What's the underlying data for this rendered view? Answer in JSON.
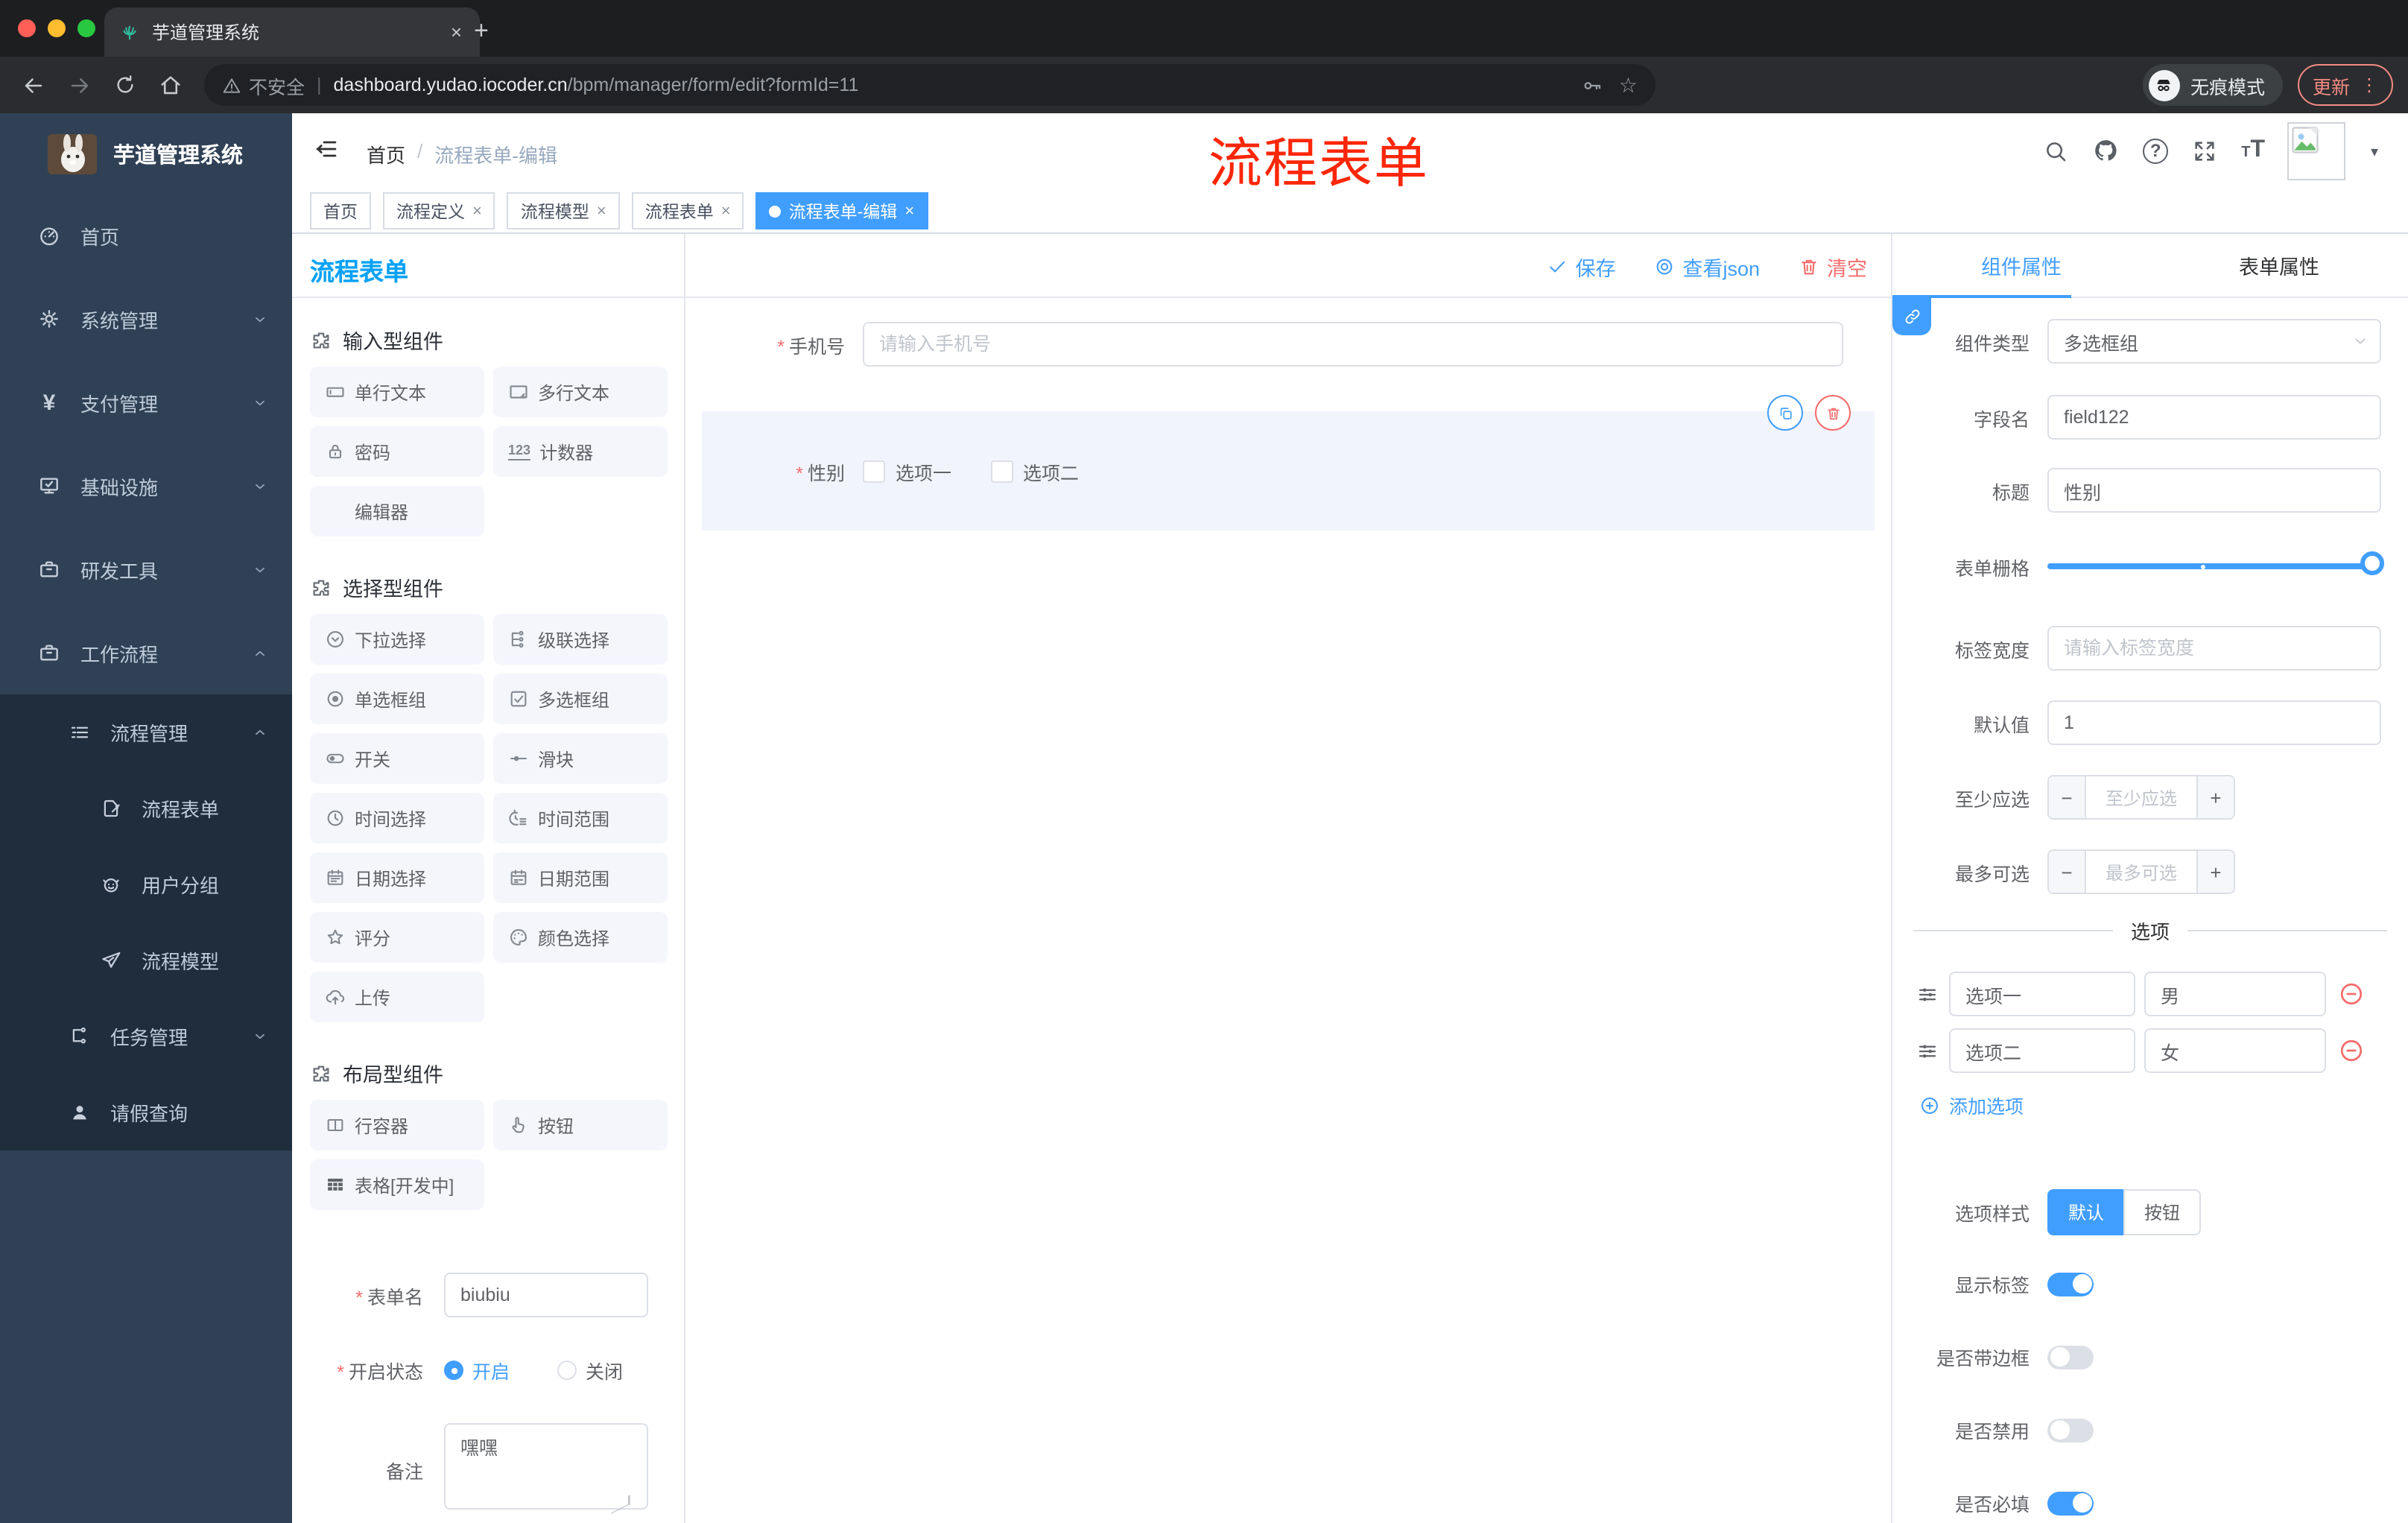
{
  "glyphs": {
    "close": "×",
    "caret": "▾",
    "slash": "/",
    "pipe": "|",
    "asterisk": "*",
    "question": "?",
    "dots": "⋮",
    "newtab": "+",
    "star": "☆",
    "yen": "¥",
    "counter": "123",
    "font_large": "T",
    "font_small": "T",
    "minus": "−",
    "plus": "+"
  },
  "colors": {
    "primary": "#409EFF",
    "danger": "#F56C6C",
    "palette_title": "#0aa2f5",
    "watermark": "#fc2608",
    "sidebar_bg": "#304156",
    "submenu_bg": "#1f2d3d",
    "active_tag": "#409EFF"
  },
  "browser": {
    "tab_title": "芋道管理系统",
    "security_label": "不安全",
    "url_host": "dashboard.yudao.iocoder.cn",
    "url_path": "/bpm/manager/form/edit?formId=11",
    "incognito_label": "无痕模式",
    "update_label": "更新"
  },
  "sidebar": {
    "logo_title": "芋道管理系统",
    "items": [
      {
        "label": "首页"
      },
      {
        "label": "系统管理"
      },
      {
        "label": "支付管理"
      },
      {
        "label": "基础设施"
      },
      {
        "label": "研发工具"
      },
      {
        "label": "工作流程"
      },
      {
        "label": "流程管理"
      },
      {
        "label": "流程表单"
      },
      {
        "label": "用户分组"
      },
      {
        "label": "流程模型"
      },
      {
        "label": "任务管理"
      },
      {
        "label": "请假查询"
      }
    ]
  },
  "header": {
    "breadcrumb_home": "首页",
    "breadcrumb_current": "流程表单-编辑",
    "watermark": "流程表单"
  },
  "tags": [
    {
      "label": "首页"
    },
    {
      "label": "流程定义"
    },
    {
      "label": "流程模型"
    },
    {
      "label": "流程表单"
    },
    {
      "label": "流程表单-编辑"
    }
  ],
  "palette": {
    "title": "流程表单",
    "sections": [
      {
        "title": "输入型组件",
        "items": [
          {
            "label": "单行文本"
          },
          {
            "label": "多行文本"
          },
          {
            "label": "密码"
          },
          {
            "label": "计数器"
          },
          {
            "label": "编辑器"
          }
        ]
      },
      {
        "title": "选择型组件",
        "items": [
          {
            "label": "下拉选择"
          },
          {
            "label": "级联选择"
          },
          {
            "label": "单选框组"
          },
          {
            "label": "多选框组"
          },
          {
            "label": "开关"
          },
          {
            "label": "滑块"
          },
          {
            "label": "时间选择"
          },
          {
            "label": "时间范围"
          },
          {
            "label": "日期选择"
          },
          {
            "label": "日期范围"
          },
          {
            "label": "评分"
          },
          {
            "label": "颜色选择"
          },
          {
            "label": "上传"
          }
        ]
      },
      {
        "title": "布局型组件",
        "items": [
          {
            "label": "行容器"
          },
          {
            "label": "按钮"
          },
          {
            "label": "表格[开发中]"
          }
        ]
      }
    ]
  },
  "form_meta": {
    "name_label": "表单名",
    "name_value": "biubiu",
    "status_label": "开启状态",
    "status_on": "开启",
    "status_off": "关闭",
    "remark_label": "备注",
    "remark_value": "嘿嘿"
  },
  "canvas": {
    "save_label": "保存",
    "view_json_label": "查看json",
    "clear_label": "清空",
    "phone_label": "手机号",
    "phone_placeholder": "请输入手机号",
    "gender_label": "性别",
    "gender_option1": "选项一",
    "gender_option2": "选项二"
  },
  "inspector": {
    "tab_component": "组件属性",
    "tab_form": "表单属性",
    "type_label": "组件类型",
    "type_value": "多选框组",
    "field_label": "字段名",
    "field_value": "field122",
    "title_label": "标题",
    "title_value": "性别",
    "grid_label": "表单栅格",
    "label_width_label": "标签宽度",
    "label_width_placeholder": "请输入标签宽度",
    "default_label": "默认值",
    "default_value": "1",
    "min_label": "至少应选",
    "min_placeholder": "至少应选",
    "max_label": "最多可选",
    "max_placeholder": "最多可选",
    "options_title": "选项",
    "options": [
      {
        "label": "选项一",
        "value": "男"
      },
      {
        "label": "选项二",
        "value": "女"
      }
    ],
    "add_option_label": "添加选项",
    "style_label": "选项样式",
    "style_default": "默认",
    "style_button": "按钮",
    "toggle_show_label": "显示标签",
    "toggle_border": "是否带边框",
    "toggle_disabled": "是否禁用",
    "toggle_required": "是否必填"
  }
}
